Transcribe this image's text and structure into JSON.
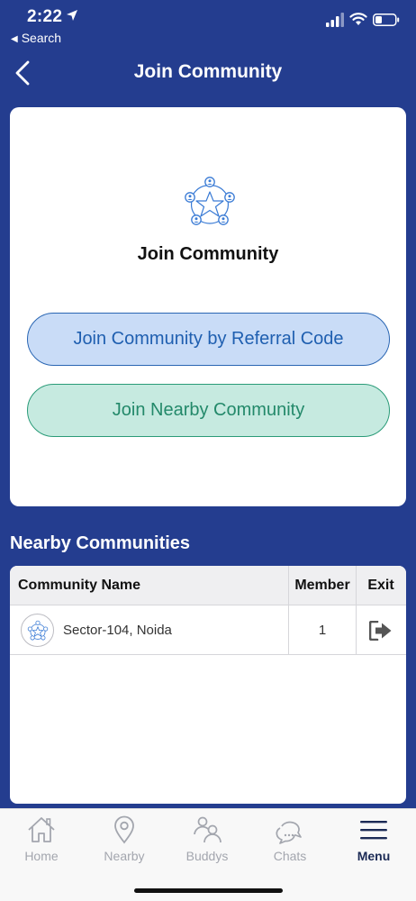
{
  "status_bar": {
    "time": "2:22",
    "back_app": "Search",
    "icons": [
      "location-arrow-icon",
      "signal-icon",
      "wifi-icon",
      "battery-icon"
    ]
  },
  "header": {
    "title": "Join Community",
    "back_icon": "chevron-left-icon"
  },
  "join_card": {
    "title": "Join Community",
    "icon": "community-network-icon",
    "referral_button": "Join Community by Referral Code",
    "nearby_button": "Join Nearby Community"
  },
  "nearby": {
    "title": "Nearby Communities",
    "columns": {
      "name": "Community Name",
      "member": "Member",
      "exit": "Exit"
    },
    "rows": [
      {
        "name": "Sector-104, Noida",
        "member": "1",
        "exit_icon": "exit-door-icon"
      }
    ]
  },
  "tabs": [
    {
      "label": "Home",
      "icon": "home-icon",
      "active": false
    },
    {
      "label": "Nearby",
      "icon": "map-pin-icon",
      "active": false
    },
    {
      "label": "Buddys",
      "icon": "users-icon",
      "active": false
    },
    {
      "label": "Chats",
      "icon": "chat-bubbles-icon",
      "active": false
    },
    {
      "label": "Menu",
      "icon": "hamburger-menu-icon",
      "active": true
    }
  ],
  "colors": {
    "background": "#243d8f",
    "referral_fill": "#c9dcf7",
    "referral_text": "#1f5fb0",
    "nearby_fill": "#c6eae0",
    "nearby_text": "#23896a",
    "active_tab": "#1b2a55",
    "inactive_tab": "#a3a6ae"
  }
}
